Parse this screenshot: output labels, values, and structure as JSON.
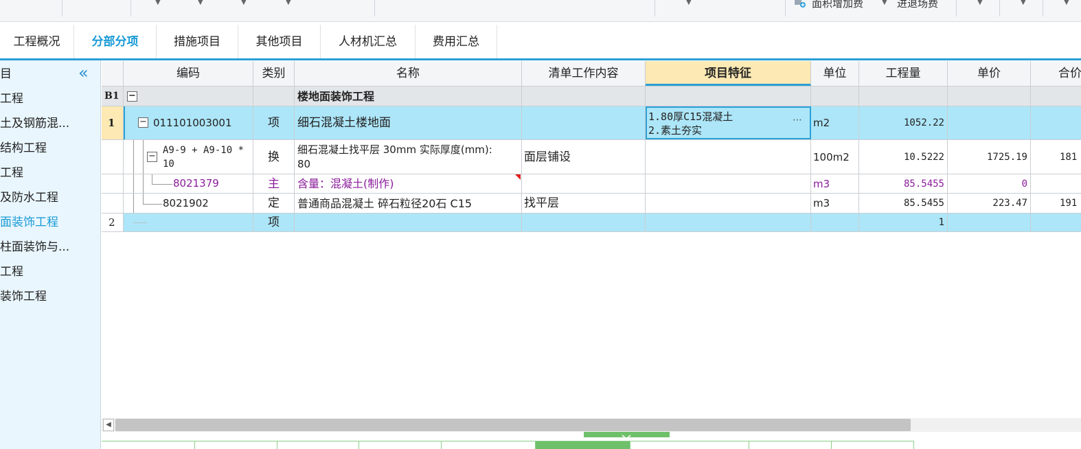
{
  "toolbar": {
    "area_fee_label": "面积增加费",
    "exit_fee_label": "进退场费"
  },
  "tabs": [
    {
      "label": "工程概况"
    },
    {
      "label": "分部分项"
    },
    {
      "label": "措施项目"
    },
    {
      "label": "其他项目"
    },
    {
      "label": "人材机汇总"
    },
    {
      "label": "费用汇总"
    }
  ],
  "sidebar": {
    "header": "目",
    "items": [
      {
        "label": "工程"
      },
      {
        "label": "土及钢筋混..."
      },
      {
        "label": "结构工程"
      },
      {
        "label": "工程"
      },
      {
        "label": "及防水工程"
      },
      {
        "label": "面装饰工程"
      },
      {
        "label": "柱面装饰与..."
      },
      {
        "label": "工程"
      },
      {
        "label": "装饰工程"
      }
    ]
  },
  "grid": {
    "columns": [
      "编码",
      "类别",
      "名称",
      "清单工作内容",
      "项目特征",
      "单位",
      "工程量",
      "单价",
      "合价"
    ],
    "rows": [
      {
        "idx": "B1",
        "code": "",
        "type": "",
        "name": "楼地面装饰工程",
        "work": "",
        "feature": "",
        "unit": "",
        "qty": "",
        "price": "",
        "total": ""
      },
      {
        "idx": "1",
        "code": "011101003001",
        "type": "项",
        "name": "细石混凝土楼地面",
        "work": "",
        "feature_line1": "1.80厚C15混凝土",
        "feature_line2": "2.素土夯实",
        "unit": "m2",
        "qty": "1052.22",
        "price": "",
        "total": ""
      },
      {
        "idx": "",
        "code_line1": "A9-9 + A9-10 *",
        "code_line2": "10",
        "type": "换",
        "name_line1": "细石混凝土找平层 30mm  实际厚度(mm):",
        "name_line2": "80",
        "work": "面层铺设",
        "feature": "",
        "unit": "100m2",
        "qty": "10.5222",
        "price": "1725.19",
        "total": "181"
      },
      {
        "idx": "",
        "code": "8021379",
        "type": "主",
        "name": "含量：混凝土(制作)",
        "work": "",
        "feature": "",
        "unit": "m3",
        "qty": "85.5455",
        "price": "0",
        "total": ""
      },
      {
        "idx": "",
        "code": "8021902",
        "type": "定",
        "name": "普通商品混凝土 碎石粒径20石 C15",
        "work": "找平层",
        "feature": "",
        "unit": "m3",
        "qty": "85.5455",
        "price": "223.47",
        "total": "191"
      },
      {
        "idx": "2",
        "code": "",
        "type": "项",
        "name": "",
        "work": "",
        "feature": "",
        "unit": "",
        "qty": "1",
        "price": "",
        "total": ""
      }
    ]
  },
  "colors": {
    "accent": "#1a9ad6",
    "selected_row": "#ade6f8",
    "feature_header": "#fde9b4",
    "main_material_text": "#8a1c9a"
  }
}
